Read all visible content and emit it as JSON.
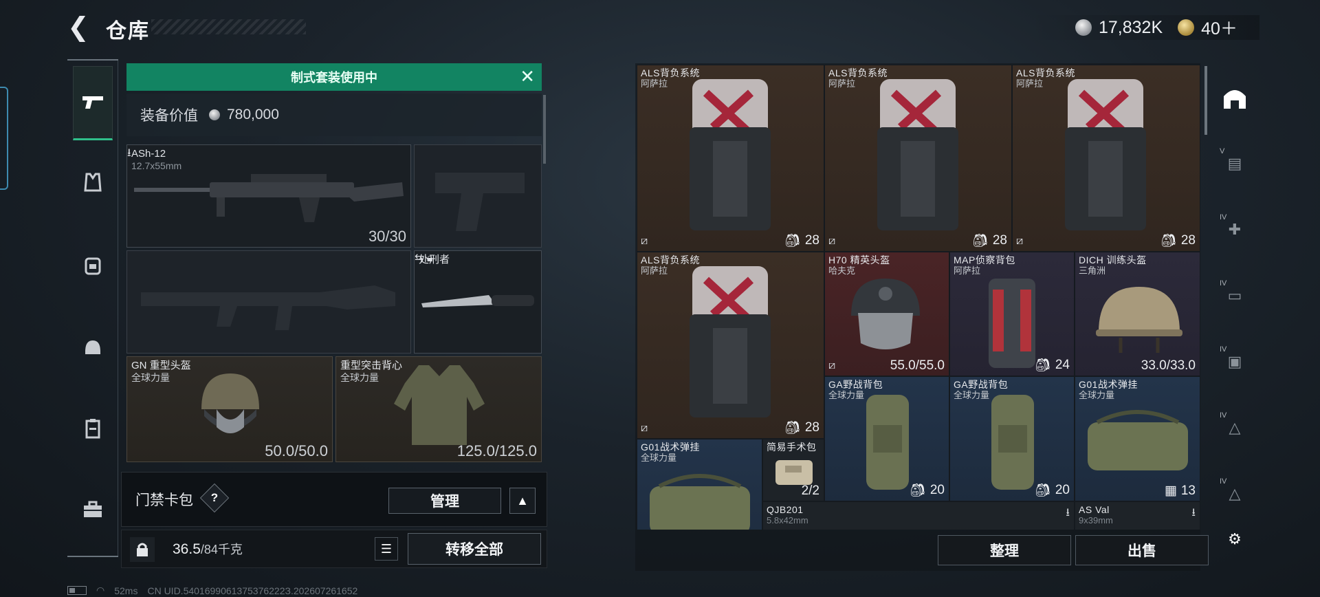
{
  "header": {
    "title": "仓库",
    "currency_silver": "17,832K",
    "currency_gold": "40＋"
  },
  "loadout": {
    "banner": "制式套装使用中",
    "value_label": "装备价值",
    "value": "780,000",
    "primary_weapon": {
      "name": "ASh-12",
      "caliber": "12.7x55mm",
      "ammo": "30/30"
    },
    "melee": {
      "name": "处刑者"
    },
    "helmet": {
      "name": "GN 重型头盔",
      "brand": "全球力量",
      "durability": "50.0/50.0"
    },
    "armor": {
      "name": "重型突击背心",
      "brand": "全球力量",
      "durability": "125.0/125.0"
    },
    "keycard_label": "门禁卡包",
    "help": "?",
    "manage_button": "管理",
    "weight_current": "36.5",
    "weight_max": "/84千克",
    "transfer_all": "转移全部"
  },
  "storage": {
    "items": [
      {
        "name": "ALS背负系统",
        "brand": "阿萨拉",
        "count": "28"
      },
      {
        "name": "ALS背负系统",
        "brand": "阿萨拉",
        "count": "28"
      },
      {
        "name": "ALS背负系统",
        "brand": "阿萨拉",
        "count": "28"
      },
      {
        "name": "ALS背负系统",
        "brand": "阿萨拉",
        "count": "28"
      },
      {
        "name": "H70 精英头盔",
        "brand": "哈夫克",
        "durability": "55.0/55.0"
      },
      {
        "name": "MAP侦察背包",
        "brand": "阿萨拉",
        "count": "24"
      },
      {
        "name": "DICH 训练头盔",
        "brand": "三角洲",
        "durability": "33.0/33.0"
      },
      {
        "name": "GA野战背包",
        "brand": "全球力量",
        "count": "20"
      },
      {
        "name": "GA野战背包",
        "brand": "全球力量",
        "count": "20"
      },
      {
        "name": "G01战术弹挂",
        "brand": "全球力量",
        "count": "13"
      },
      {
        "name": "G01战术弹挂",
        "brand": "全球力量"
      },
      {
        "name": "简易手术包",
        "count": "2/2"
      },
      {
        "name": "QJB201",
        "caliber": "5.8x42mm"
      },
      {
        "name": "AS Val",
        "caliber": "9x39mm"
      }
    ],
    "sort_button": "整理",
    "sell_button": "出售"
  },
  "footer": {
    "ping": "52ms",
    "uid": "CN UID.5401699061375376222З.202607261652"
  },
  "colors": {
    "banner_green": "#128462",
    "rarity_gold": "#3b2e25",
    "rarity_red": "#4a2426",
    "rarity_purple": "#2c2a3a",
    "rarity_blue": "#23344a"
  },
  "icons": {
    "back": "chevron-left-icon",
    "category_tabs": [
      "pistol-icon",
      "vest-icon",
      "backpack-icon",
      "helmet-icon",
      "medkit-icon",
      "toolbox-icon"
    ],
    "filters": [
      "all-icon",
      "weapon-filter-icon",
      "medical-filter-icon",
      "ammo-filter-icon",
      "keys-filter-icon",
      "loot-filter-icon",
      "misc-filter-icon",
      "settings-icon"
    ],
    "filter_levels": [
      "V",
      "IV",
      "IV",
      "IV",
      "IV",
      "IV"
    ]
  }
}
